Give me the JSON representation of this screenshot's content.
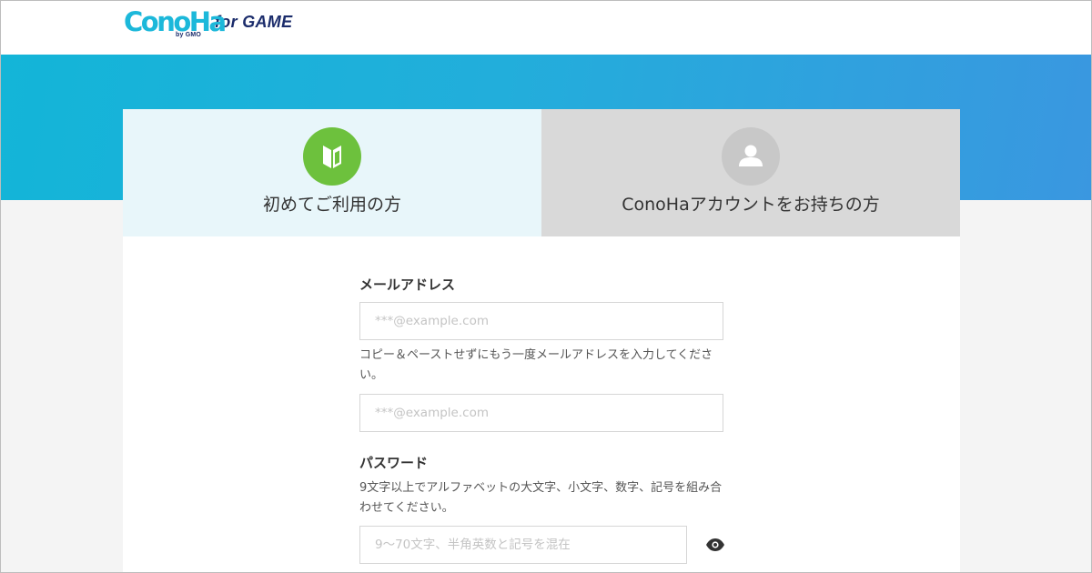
{
  "header": {
    "logo_text": "ConoHa",
    "logo_byline": "by GMO",
    "logo_suffix": "for GAME"
  },
  "tabs": [
    {
      "label": "初めてご利用の方",
      "icon": "beginner-mark-icon",
      "active": true
    },
    {
      "label": "ConoHaアカウントをお持ちの方",
      "icon": "user-icon",
      "active": false
    }
  ],
  "form": {
    "email": {
      "label": "メールアドレス",
      "placeholder": "***@example.com",
      "value": ""
    },
    "email_confirm": {
      "helper": "コピー＆ペーストせずにもう一度メールアドレスを入力してください。",
      "placeholder": "***@example.com",
      "value": ""
    },
    "password": {
      "label": "パスワード",
      "helper": "9文字以上でアルファベットの大文字、小文字、数字、記号を組み合わせてください。",
      "placeholder": "9～70文字、半角英数と記号を混在",
      "value": "",
      "toggle_icon": "eye-icon"
    }
  },
  "colors": {
    "brand_cyan": "#1cb8da",
    "brand_navy": "#1b2c6b",
    "beginner_green": "#6dc13d",
    "hero_start": "#13b5d8",
    "hero_end": "#3a97e0"
  }
}
